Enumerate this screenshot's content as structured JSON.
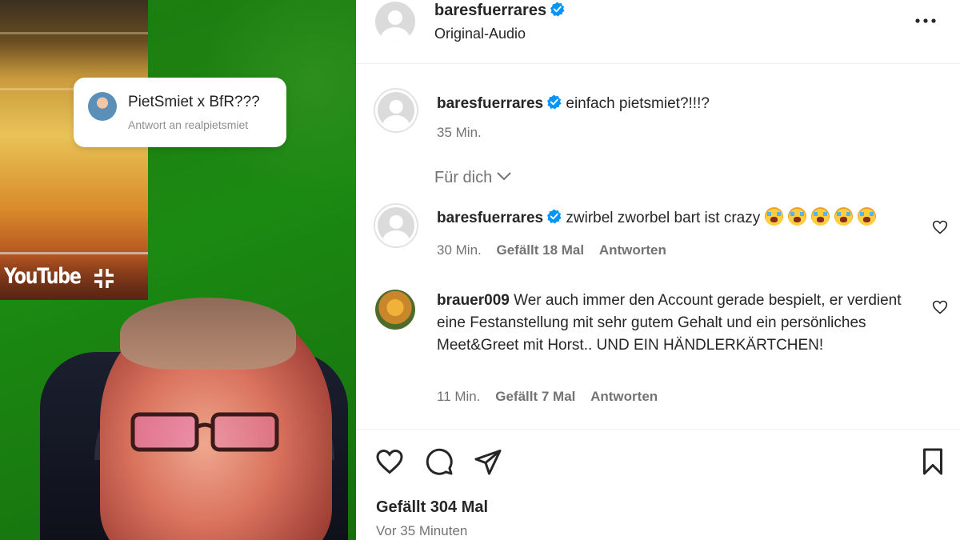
{
  "media": {
    "reply_card": {
      "title": "PietSmiet x BfR???",
      "subtitle": "Antwort an realpietsmiet"
    },
    "watermark": "YouTube"
  },
  "header": {
    "username": "baresfuerrares",
    "audio": "Original-Audio",
    "more_icon": "more-horizontal-icon"
  },
  "caption": {
    "username": "baresfuerrares",
    "text": "einfach pietsmiet?!!!?",
    "time": "35 Min."
  },
  "for_you_label": "Für dich",
  "comments": [
    {
      "username": "baresfuerrares",
      "text": "zwirbel zworbel bart ist crazy",
      "emoji_count": 5,
      "time": "30 Min.",
      "likes": "Gefällt 18 Mal",
      "reply": "Antworten"
    },
    {
      "username": "brauer009",
      "text": "Wer auch immer den Account gerade bespielt, er verdient eine Festanstellung mit sehr gutem Gehalt und ein persönliches Meet&Greet mit Horst.. UND EIN HÄNDLERKÄRTCHEN!",
      "time": "11 Min.",
      "likes": "Gefällt 7 Mal",
      "reply": "Antworten"
    }
  ],
  "actions": {
    "icons": [
      "heart-icon",
      "comment-icon",
      "share-icon",
      "bookmark-icon"
    ],
    "likes": "Gefällt 304 Mal",
    "time_ago": "Vor 35 Minuten"
  },
  "colors": {
    "verified": "#0095f6",
    "meta_text": "#737373",
    "text": "#262626",
    "green_screen": "#1b8a12"
  }
}
